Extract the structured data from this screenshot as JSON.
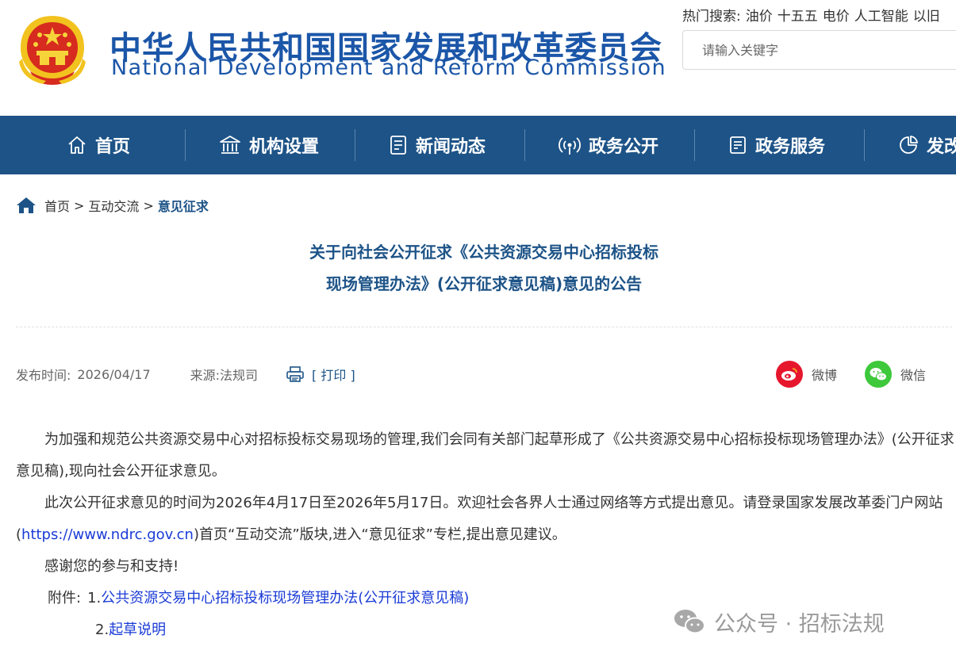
{
  "header": {
    "title_cn": "中华人民共和国国家发展和改革委员会",
    "title_en": "National Development and Reform Commission",
    "hot_label": "热门搜索:",
    "hot_items": [
      "油价",
      "十五五",
      "电价",
      "人工智能",
      "以旧"
    ],
    "search_placeholder": "请输入关键字"
  },
  "nav": {
    "items": [
      {
        "label": "首页",
        "icon": "home-icon"
      },
      {
        "label": "机构设置",
        "icon": "institution-icon"
      },
      {
        "label": "新闻动态",
        "icon": "news-icon"
      },
      {
        "label": "政务公开",
        "icon": "broadcast-icon"
      },
      {
        "label": "政务服务",
        "icon": "document-icon"
      },
      {
        "label": "发改",
        "icon": "pie-chart-icon"
      }
    ]
  },
  "breadcrumb": {
    "items": [
      "首页",
      "互动交流"
    ],
    "current": "意见征求",
    "separator": ">"
  },
  "article": {
    "title_line1": "关于向社会公开征求《公共资源交易中心招标投标",
    "title_line2": "现场管理办法》(公开征求意见稿)意见的公告",
    "publish_label": "发布时间:",
    "publish_date": "2026/04/17",
    "source_label": "来源:",
    "source": "法规司",
    "print_label": "[ 打印 ]",
    "share_weibo": "微博",
    "share_wechat": "微信",
    "para1": "为加强和规范公共资源交易中心对招标投标交易现场的管理,我们会同有关部门起草形成了《公共资源交易中心招标投标现场管理办法》(公开征求意见稿),现向社会公开征求意见。",
    "para2_a": "此次公开征求意见的时间为2026年4月17日至2026年5月17日。欢迎社会各界人士通过网络等方式提出意见。请登录国家发展改革委门户网站(",
    "para2_link": "https://www.ndrc.gov.cn",
    "para2_b": ")首页“互动交流”版块,进入“意见征求”专栏,提出意见建议。",
    "para3": "感谢您的参与和支持!",
    "attach_label": "附件:",
    "attach1_num": "1.",
    "attach1_link": "公共资源交易中心招标投标现场管理办法(公开征求意见稿)",
    "attach2_num": "2.",
    "attach2_link": "起草说明"
  },
  "watermark": "公众号 · 招标法规",
  "colors": {
    "brand_blue": "#1b56a8",
    "nav_bg": "#1d5387",
    "link_blue": "#1a3bd6",
    "weibo_red": "#e6162d",
    "wechat_green": "#3ec83b"
  }
}
